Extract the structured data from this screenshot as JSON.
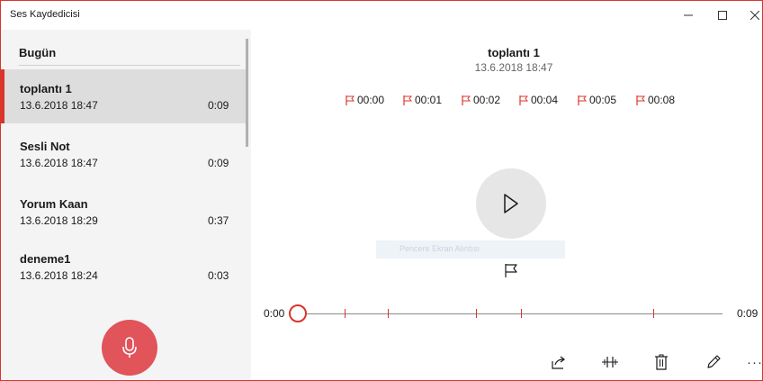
{
  "window": {
    "app_title": "Ses Kaydedicisi",
    "accent_color": "#d9352b"
  },
  "sidebar": {
    "section_header": "Bugün",
    "recordings": [
      {
        "name": "toplantı 1",
        "date": "13.6.2018 18:47",
        "duration": "0:09",
        "selected": true
      },
      {
        "name": "Sesli Not",
        "date": "13.6.2018 18:47",
        "duration": "0:09",
        "selected": false
      },
      {
        "name": "Yorum Kaan",
        "date": "13.6.2018 18:29",
        "duration": "0:37",
        "selected": false
      },
      {
        "name": "deneme1",
        "date": "13.6.2018 18:24",
        "duration": "0:03",
        "selected": false
      }
    ],
    "record_button_icon": "microphone-icon"
  },
  "player": {
    "title": "toplantı 1",
    "subtitle": "13.6.2018 18:47",
    "markers": [
      "00:00",
      "00:01",
      "00:02",
      "00:04",
      "00:05",
      "00:08"
    ],
    "tooltip_text": "Pencere Ekran Alıntısı",
    "time_start": "0:00",
    "time_end": "0:09",
    "progress": 0,
    "marker_seconds": [
      0,
      1,
      2,
      4,
      5,
      8
    ]
  },
  "toolbar": {
    "icons": [
      "share-icon",
      "trim-icon",
      "delete-icon",
      "rename-icon",
      "more-icon"
    ],
    "more_label": "···"
  }
}
